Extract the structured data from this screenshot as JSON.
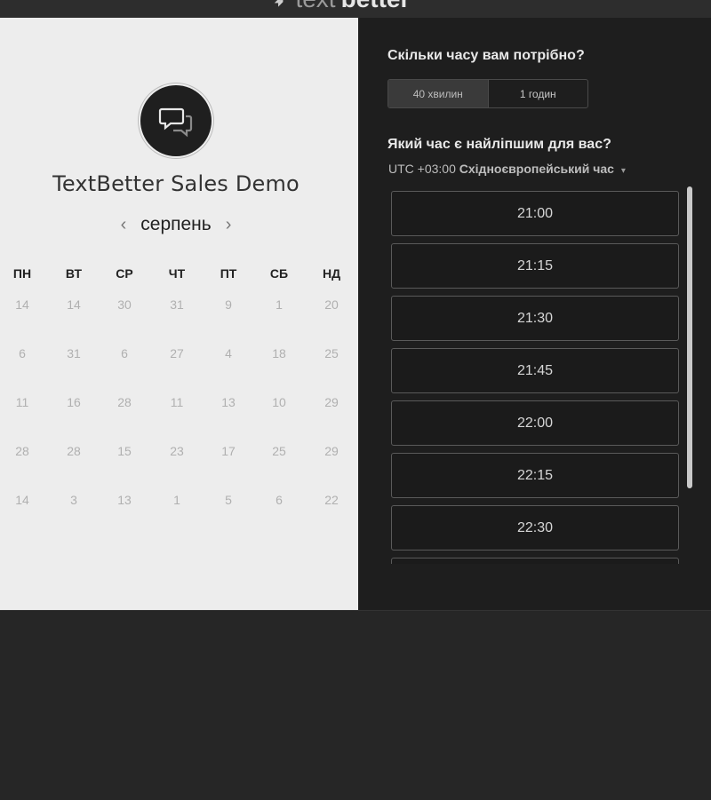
{
  "logo": {
    "text_light": "text",
    "text_bold": "better"
  },
  "event": {
    "title": "TextBetter Sales Demo",
    "icon": "chat-bubbles-icon"
  },
  "calendar": {
    "month": "серпень",
    "prev": "‹",
    "next": "›",
    "weekdays": [
      "ПН",
      "ВТ",
      "СР",
      "ЧТ",
      "ПТ",
      "СБ",
      "НД"
    ],
    "weeks": [
      [
        "14",
        "14",
        "30",
        "31",
        "9",
        "1",
        "20"
      ],
      [
        "6",
        "31",
        "6",
        "27",
        "4",
        "18",
        "25"
      ],
      [
        "11",
        "16",
        "28",
        "11",
        "13",
        "10",
        "29"
      ],
      [
        "28",
        "28",
        "15",
        "23",
        "17",
        "25",
        "29"
      ],
      [
        "14",
        "3",
        "13",
        "1",
        "5",
        "6",
        "22"
      ]
    ]
  },
  "duration": {
    "question": "Скільки часу вам потрібно?",
    "options": [
      "40 хвилин",
      "1 годин"
    ],
    "selected": "40 хвилин"
  },
  "time": {
    "question": "Який час є найліпшим для вас?",
    "tz_offset": "UTC +03:00",
    "tz_name": "Східноєвропейський час",
    "caret": "▾",
    "slots": [
      "21:00",
      "21:15",
      "21:30",
      "21:45",
      "22:00",
      "22:15",
      "22:30",
      ""
    ]
  },
  "colors": {
    "left_bg": "#ededed",
    "right_bg": "#1e1e1e",
    "page_bg": "#262626"
  }
}
